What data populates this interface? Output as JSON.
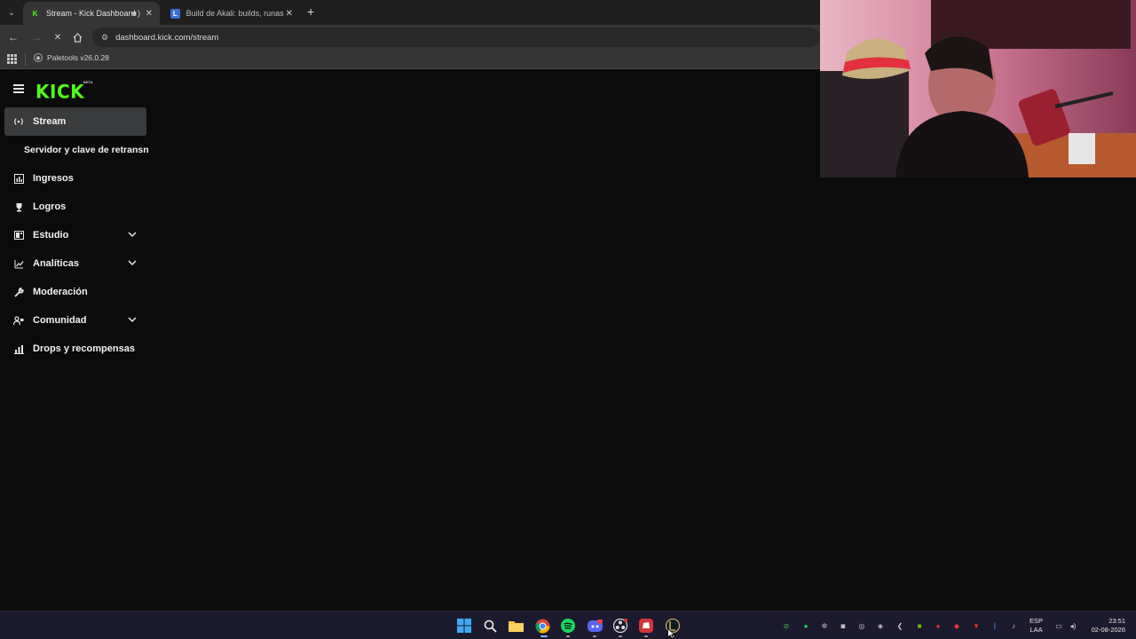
{
  "browser": {
    "tabs": [
      {
        "title": "Stream - Kick Dashboard",
        "active": true,
        "favicon": "kick-favicon"
      },
      {
        "title": "Build de Akali: builds, runas e o",
        "active": false,
        "favicon": "leagueofgraphs-favicon"
      }
    ],
    "url": "dashboard.kick.com/stream",
    "bookmark": "Paletools v26.0.28"
  },
  "kick": {
    "logo": "KICK",
    "beta": "BETA",
    "nav": [
      {
        "label": "Stream",
        "icon": "broadcast-icon",
        "active": true
      },
      {
        "label": "Servidor y clave de retransn",
        "icon": "",
        "sub": true
      },
      {
        "label": "Ingresos",
        "icon": "chart-icon"
      },
      {
        "label": "Logros",
        "icon": "trophy-icon"
      },
      {
        "label": "Estudio",
        "icon": "studio-icon",
        "expandable": true
      },
      {
        "label": "Analíticas",
        "icon": "analytics-icon",
        "expandable": true
      },
      {
        "label": "Moderación",
        "icon": "wrench-icon"
      },
      {
        "label": "Comunidad",
        "icon": "community-icon",
        "expandable": true
      },
      {
        "label": "Drops y recompensas",
        "icon": "drops-icon"
      }
    ]
  },
  "taskbar": {
    "language": [
      "ESP",
      "LAA"
    ],
    "time": "23:51",
    "date": "02-08-2026"
  },
  "colors": {
    "kick_green": "#53fc18",
    "background": "#0b0b0c",
    "active_item": "#3a3b3d"
  }
}
